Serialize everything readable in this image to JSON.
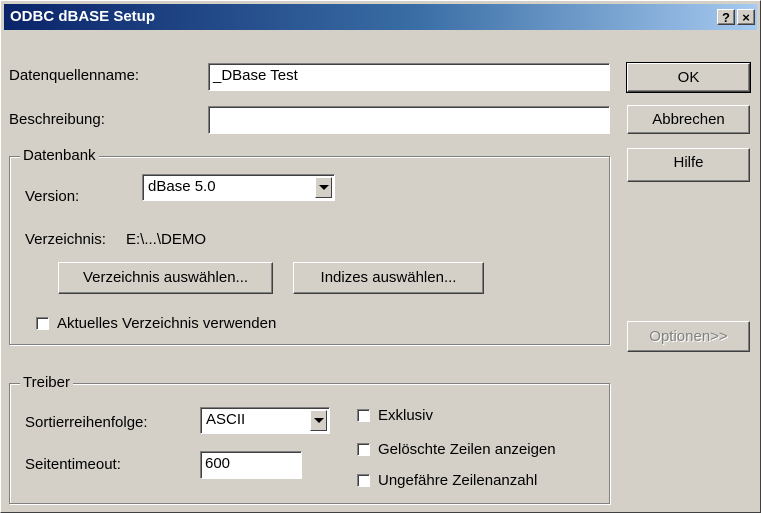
{
  "window": {
    "title": "ODBC dBASE Setup",
    "help_button": "?",
    "close_button": "×"
  },
  "form": {
    "datasource_label": "Datenquellenname:",
    "datasource_value": "_DBase Test",
    "description_label": "Beschreibung:",
    "description_value": ""
  },
  "buttons": {
    "ok": "OK",
    "cancel": "Abbrechen",
    "help": "Hilfe",
    "options": "Optionen>>"
  },
  "database": {
    "group_title": "Datenbank",
    "version_label": "Version:",
    "version_value": "dBase 5.0",
    "directory_label": "Verzeichnis:",
    "directory_value": "E:\\...\\DEMO",
    "select_directory_button": "Verzeichnis auswählen...",
    "select_indexes_button": "Indizes auswählen...",
    "use_current_dir_label": "Aktuelles Verzeichnis verwenden",
    "use_current_dir_checked": false
  },
  "driver": {
    "group_title": "Treiber",
    "sort_order_label": "Sortierreihenfolge:",
    "sort_order_value": "ASCII",
    "page_timeout_label": "Seitentimeout:",
    "page_timeout_value": "600",
    "exclusive_label": "Exklusiv",
    "show_deleted_label": "Gelöschte Zeilen anzeigen",
    "approx_rowcount_label": "Ungefähre Zeilenanzahl"
  }
}
